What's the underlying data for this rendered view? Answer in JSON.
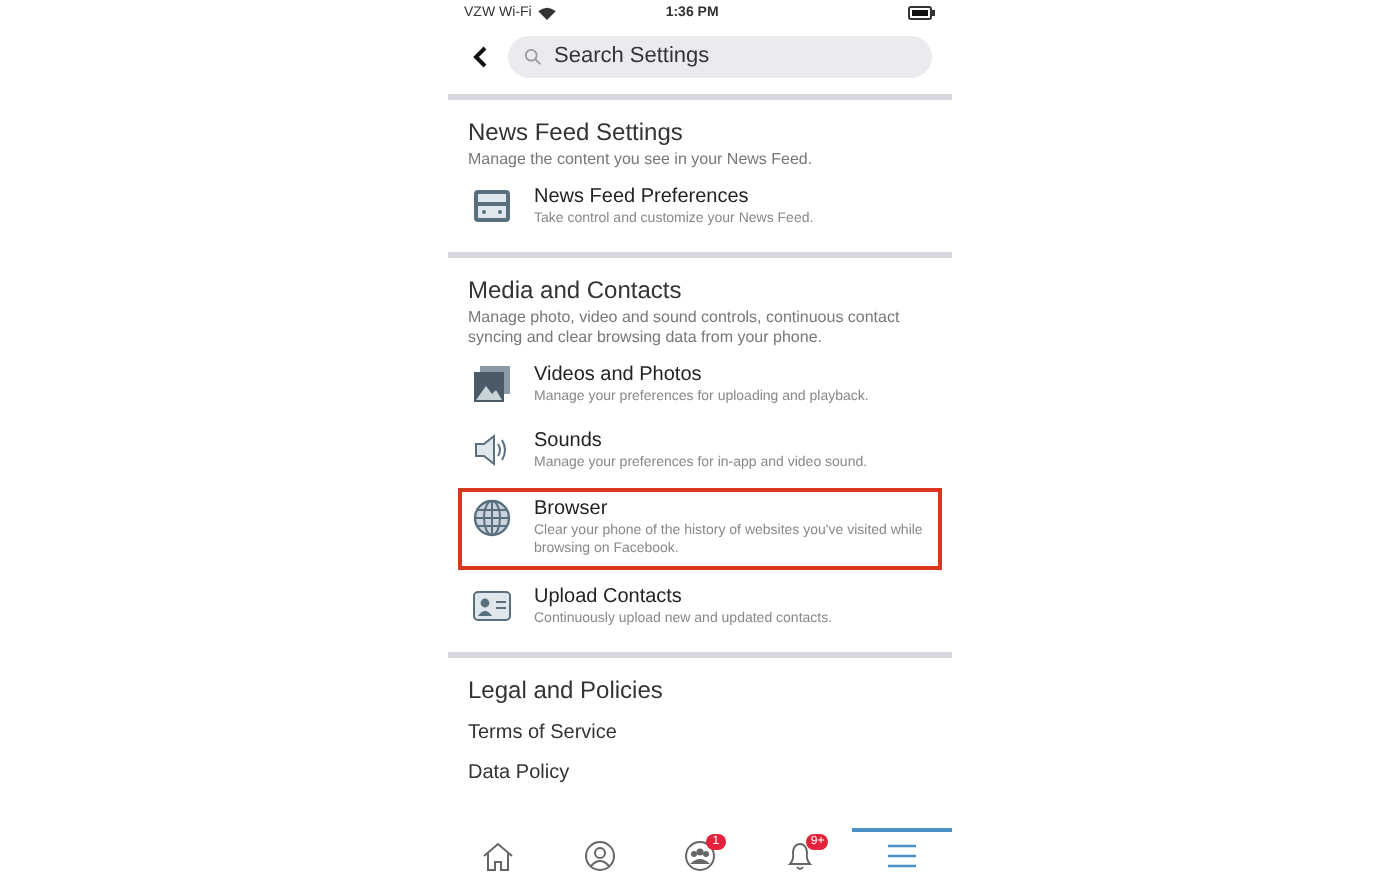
{
  "status_bar": {
    "carrier": "VZW Wi-Fi",
    "time": "1:36 PM"
  },
  "search": {
    "placeholder": "Search Settings"
  },
  "sections": [
    {
      "title": "News Feed Settings",
      "description": "Manage the content you see in your News Feed.",
      "items": [
        {
          "kind": "item",
          "title": "News Feed Preferences",
          "description": "Take control and customize your News Feed.",
          "highlighted": false
        }
      ]
    },
    {
      "title": "Media and Contacts",
      "description": "Manage photo, video and sound controls, continuous contact syncing and clear browsing data from your phone.",
      "items": [
        {
          "kind": "item",
          "title": "Videos and Photos",
          "description": "Manage your preferences for uploading and playback.",
          "highlighted": false
        },
        {
          "kind": "item",
          "title": "Sounds",
          "description": "Manage your preferences for in-app and video sound.",
          "highlighted": false
        },
        {
          "kind": "item",
          "title": "Browser",
          "description": "Clear your phone of the history of websites you've visited while browsing on Facebook.",
          "highlighted": true
        },
        {
          "kind": "item",
          "title": "Upload Contacts",
          "description": "Continuously upload new and updated contacts.",
          "highlighted": false
        }
      ]
    },
    {
      "title": "Legal and Policies",
      "items": [
        {
          "kind": "link",
          "title": "Terms of Service"
        },
        {
          "kind": "link",
          "title": "Data Policy"
        }
      ]
    }
  ],
  "tab_bar": [
    {
      "selected": false
    },
    {
      "selected": false
    },
    {
      "badge": "1",
      "selected": false
    },
    {
      "badge": "9+",
      "selected": false
    },
    {
      "selected": true
    }
  ]
}
